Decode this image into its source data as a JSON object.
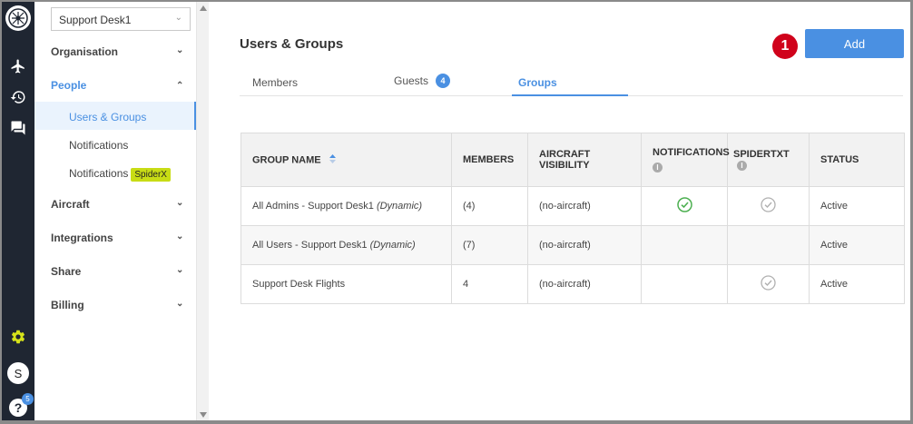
{
  "sidebar": {
    "org_select": "Support Desk1",
    "sections": {
      "organisation": "Organisation",
      "people": "People",
      "aircraft": "Aircraft",
      "integrations": "Integrations",
      "share": "Share",
      "billing": "Billing"
    },
    "people_items": {
      "users_groups": "Users & Groups",
      "notifications": "Notifications",
      "notifications_spiderx": "Notifications",
      "spiderx_tag": "SpiderX"
    }
  },
  "rail": {
    "avatar_initial": "S",
    "help_glyph": "?",
    "help_badge": "5"
  },
  "header": {
    "title": "Users & Groups",
    "step_badge": "1",
    "add_label": "Add"
  },
  "tabs": {
    "members": "Members",
    "guests": "Guests",
    "guests_count": "4",
    "groups": "Groups"
  },
  "table": {
    "headers": {
      "group_name": "GROUP NAME",
      "members": "MEMBERS",
      "aircraft_visibility": "AIRCRAFT VISIBILITY",
      "notifications": "NOTIFICATIONS",
      "spidertxt": "SPIDERTXT",
      "status": "STATUS"
    },
    "rows": [
      {
        "name": "All Admins - Support Desk1",
        "qualifier": "(Dynamic)",
        "members": "(4)",
        "aircraft": "(no-aircraft)",
        "notifications": true,
        "spidertxt": true,
        "status": "Active"
      },
      {
        "name": "All Users - Support Desk1",
        "qualifier": "(Dynamic)",
        "members": "(7)",
        "aircraft": "(no-aircraft)",
        "notifications": false,
        "spidertxt": false,
        "status": "Active"
      },
      {
        "name": "Support Desk Flights",
        "qualifier": "",
        "members": "4",
        "aircraft": "(no-aircraft)",
        "notifications": false,
        "spidertxt": true,
        "status": "Active"
      }
    ]
  },
  "colors": {
    "accent": "#4a90e2",
    "rail": "#1f2632",
    "step_badge": "#d0021b",
    "tag": "#c8dc15",
    "check_active": "#4caf50",
    "check_muted": "#b0b0b0"
  }
}
